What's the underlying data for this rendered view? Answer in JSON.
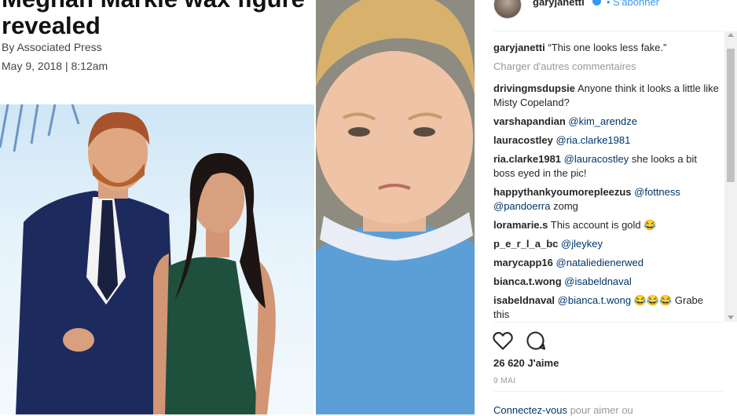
{
  "article": {
    "headline": "Meghan Markle wax figure revealed",
    "byline": "By Associated Press",
    "dateline": "May 9, 2018 | 8:12am"
  },
  "post": {
    "username": "garyjanetti",
    "follow_label": "S'abonner",
    "load_more": "Charger d'autres commentaires",
    "likes": "26 620 J'aime",
    "date": "9 MAI",
    "login_link": "Connectez-vous",
    "login_rest": " pour aimer ou"
  },
  "comments": [
    {
      "user": "garyjanetti",
      "text": "“This one looks less fake.”",
      "mention": ""
    },
    {
      "user": "drivingmsdupsie",
      "text": "Anyone think it looks a little like Misty Copeland?",
      "mention": ""
    },
    {
      "user": "varshapandian",
      "mention": "@kim_arendze",
      "text": ""
    },
    {
      "user": "lauracostley",
      "mention": "@ria.clarke1981",
      "text": ""
    },
    {
      "user": "ria.clarke1981",
      "mention": "@lauracostley",
      "text": "she looks a bit boss eyed in the pic!"
    },
    {
      "user": "happythankyoumorepleezus",
      "mention": "@fottness @pandoerra",
      "text": "zomg"
    },
    {
      "user": "loramarie.s",
      "mention": "",
      "text": "This account is gold 😂"
    },
    {
      "user": "p_e_r_l_a_bc",
      "mention": "@jleykey",
      "text": ""
    },
    {
      "user": "marycapp16",
      "mention": "@nataliedienerwed",
      "text": ""
    },
    {
      "user": "bianca.t.wong",
      "mention": "@isabeldnaval",
      "text": ""
    },
    {
      "user": "isabeldnaval",
      "mention": "@bianca.t.wong",
      "text": "😂😂😂 Grabe this"
    }
  ],
  "icons": {
    "like": "heart-outline-icon",
    "comment": "speech-bubble-icon",
    "verified": "verified-badge-icon"
  },
  "colors": {
    "link": "#003569",
    "follow": "#3897f0",
    "muted": "#999999"
  }
}
